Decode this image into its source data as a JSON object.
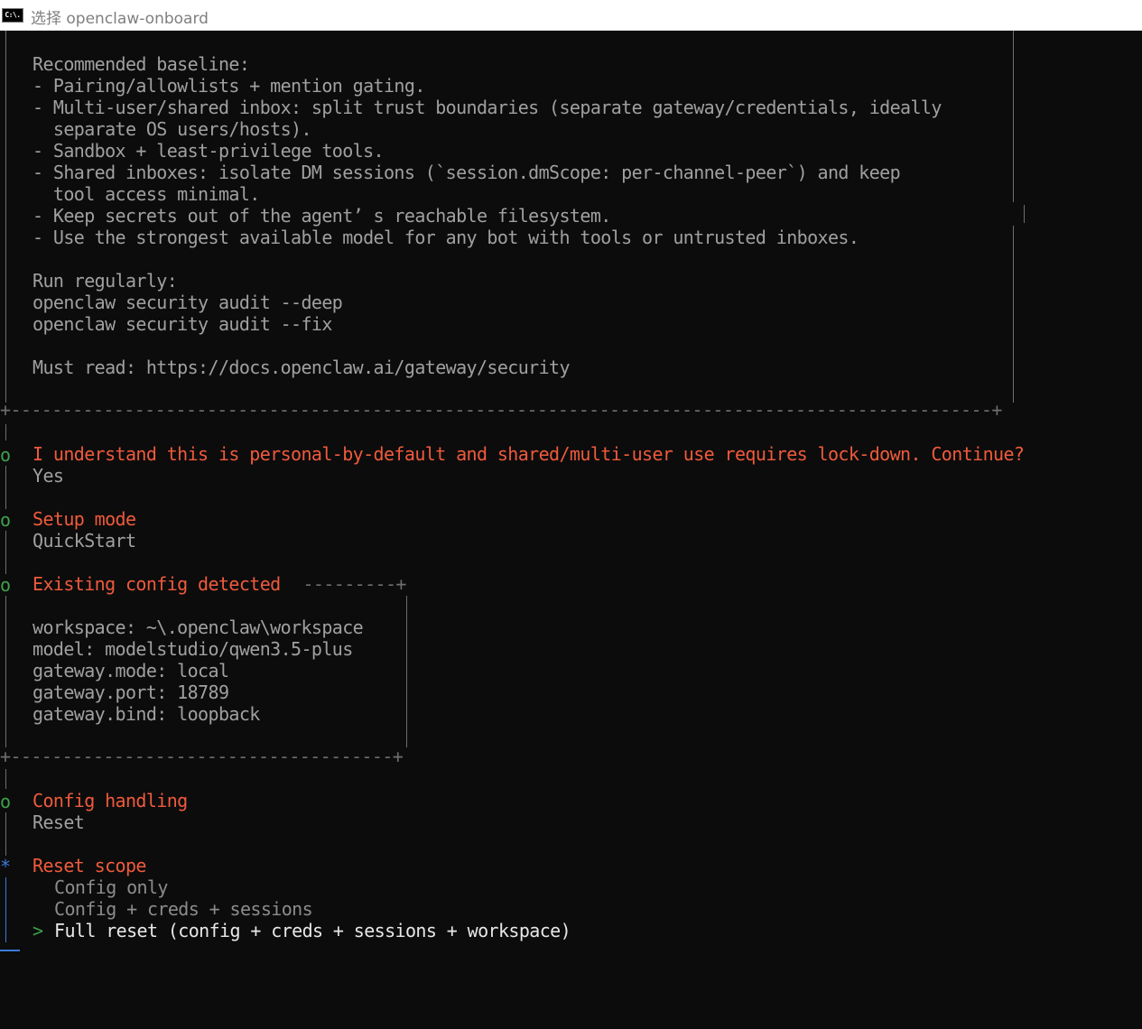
{
  "window": {
    "title": "选择 openclaw-onboard",
    "icon_label": "C:\\."
  },
  "security_box": {
    "baseline_heading": "Recommended baseline:",
    "baseline_items": [
      "- Pairing/allowlists + mention gating.",
      "- Multi-user/shared inbox: split trust boundaries (separate gateway/credentials, ideally",
      "  separate OS users/hosts).",
      "- Sandbox + least-privilege tools.",
      "- Shared inboxes: isolate DM sessions (`session.dmScope: per-channel-peer`) and keep",
      "  tool access minimal.",
      "- Keep secrets out of the agent’ s reachable filesystem.",
      "- Use the strongest available model for any bot with tools or untrusted inboxes."
    ],
    "run_heading": "Run regularly:",
    "run_commands": [
      "openclaw security audit --deep",
      "openclaw security audit --fix"
    ],
    "must_read": "Must read: https://docs.openclaw.ai/gateway/security"
  },
  "prompts": {
    "understand": {
      "marker": "o",
      "question": "I understand this is personal-by-default and shared/multi-user use requires lock-down. Continue?",
      "answer": "Yes"
    },
    "setup_mode": {
      "marker": "o",
      "question": "Setup mode",
      "answer": "QuickStart"
    },
    "existing_config": {
      "marker": "o",
      "title": "Existing config detected",
      "title_dashes": " ---------+",
      "items": [
        "workspace: ~\\.openclaw\\workspace",
        "model: modelstudio/qwen3.5-plus",
        "gateway.mode: local",
        "gateway.port: 18789",
        "gateway.bind: loopback"
      ]
    },
    "config_handling": {
      "marker": "o",
      "question": "Config handling",
      "answer": "Reset"
    },
    "reset_scope": {
      "marker": "*",
      "question": "Reset scope",
      "options": [
        {
          "label": "Config only",
          "selected": false
        },
        {
          "label": "Config + creds + sessions",
          "selected": false
        },
        {
          "label": "Full reset (config + creds + sessions + workspace)",
          "selected": true
        }
      ],
      "cursor": ">"
    }
  },
  "colors": {
    "accent": "#f05a3c",
    "green_marker": "#3fa04a",
    "blue_marker": "#3a7ad9",
    "background": "#0c0c0c"
  }
}
